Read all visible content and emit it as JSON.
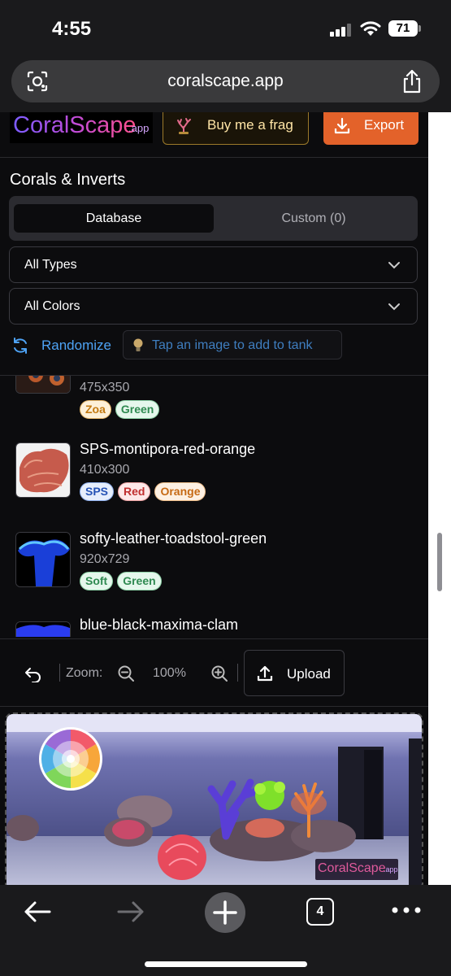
{
  "status_bar": {
    "time": "4:55",
    "battery": "71"
  },
  "browser": {
    "url": "coralscape.app",
    "tab_count": "4"
  },
  "header": {
    "logo": "CoralScape",
    "logo_suffix": ".app",
    "frag_button": "Buy me a frag",
    "export_button": "Export"
  },
  "panel": {
    "title": "Corals & Inverts",
    "tabs": [
      {
        "label": "Database",
        "active": true
      },
      {
        "label": "Custom (0)",
        "active": false
      }
    ],
    "type_filter": "All Types",
    "color_filter": "All Colors",
    "randomize_label": "Randomize",
    "tip": "Tap an image to add to tank"
  },
  "items": [
    {
      "name": "",
      "size": "475x350",
      "tags": [
        {
          "label": "Zoa",
          "color": "#f5a623"
        },
        {
          "label": "Green",
          "color": "#3fbf6b"
        }
      ]
    },
    {
      "name": "SPS-montipora-red-orange",
      "size": "410x300",
      "tags": [
        {
          "label": "SPS",
          "color": "#3b6fe0"
        },
        {
          "label": "Red",
          "color": "#e04545"
        },
        {
          "label": "Orange",
          "color": "#f08a24"
        }
      ]
    },
    {
      "name": "softy-leather-toadstool-green",
      "size": "920x729",
      "tags": [
        {
          "label": "Soft",
          "color": "#3fbf6b"
        },
        {
          "label": "Green",
          "color": "#3fbf6b"
        }
      ]
    },
    {
      "name": "blue-black-maxima-clam",
      "size": "",
      "tags": []
    }
  ],
  "toolbar": {
    "zoom_label": "Zoom:",
    "zoom_value": "100%",
    "upload_label": "Upload"
  },
  "tank": {
    "watermark": "CoralScape",
    "watermark_suffix": ".app"
  },
  "colors": {
    "accent_orange": "#e3622a",
    "link_blue": "#4ea3f5",
    "background": "#0c0c0e"
  }
}
